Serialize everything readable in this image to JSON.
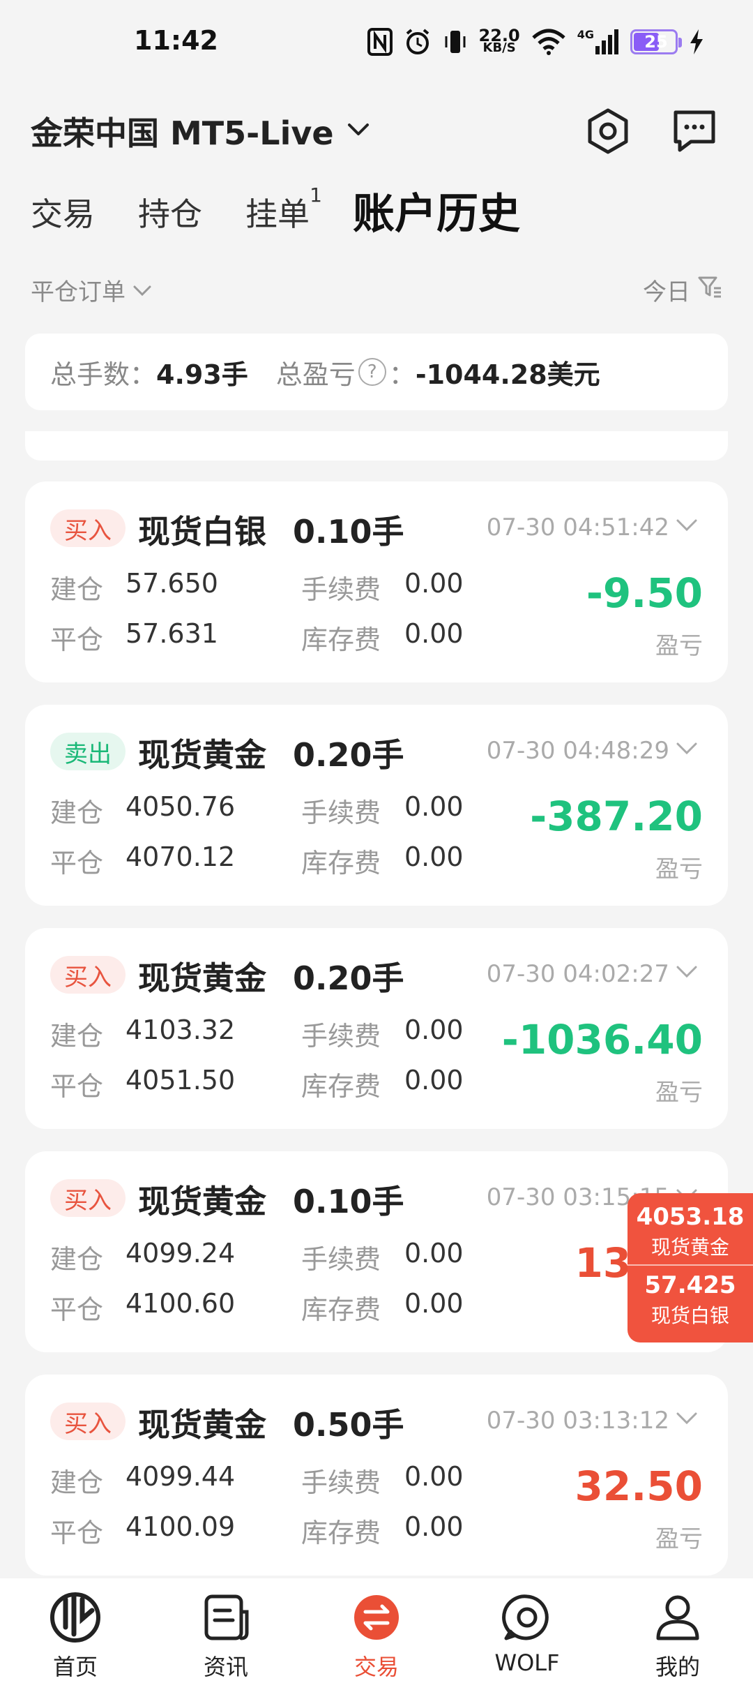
{
  "status_bar": {
    "time": "11:42",
    "net_speed": "22.0",
    "net_unit": "KB/S",
    "network": "4G",
    "battery": "25"
  },
  "header": {
    "account": "金荣中国 MT5-Live"
  },
  "tabs": [
    {
      "label": "交易"
    },
    {
      "label": "持仓"
    },
    {
      "label": "挂单",
      "count": "1"
    },
    {
      "label": "账户历史",
      "active": true
    }
  ],
  "filter": {
    "type": "平仓订单",
    "range": "今日"
  },
  "summary": {
    "lots_label": "总手数：",
    "lots_value": "4.93手",
    "pl_label": "总盈亏",
    "pl_colon": "：",
    "pl_value": "-1044.28美元"
  },
  "labels": {
    "open": "建仓",
    "close": "平仓",
    "fee": "手续费",
    "swap": "库存费",
    "pl": "盈亏"
  },
  "trades": [
    {
      "side": "买入",
      "symbol": "现货白银",
      "lots": "0.10手",
      "time": "07-30 04:51:42",
      "open": "57.650",
      "close": "57.631",
      "fee": "0.00",
      "swap": "0.00",
      "pl": "-9.50"
    },
    {
      "side": "卖出",
      "symbol": "现货黄金",
      "lots": "0.20手",
      "time": "07-30 04:48:29",
      "open": "4050.76",
      "close": "4070.12",
      "fee": "0.00",
      "swap": "0.00",
      "pl": "-387.20"
    },
    {
      "side": "买入",
      "symbol": "现货黄金",
      "lots": "0.20手",
      "time": "07-30 04:02:27",
      "open": "4103.32",
      "close": "4051.50",
      "fee": "0.00",
      "swap": "0.00",
      "pl": "-1036.40"
    },
    {
      "side": "买入",
      "symbol": "现货黄金",
      "lots": "0.10手",
      "time": "07-30 03:15:15",
      "open": "4099.24",
      "close": "4100.60",
      "fee": "0.00",
      "swap": "0.00",
      "pl": "13.60"
    },
    {
      "side": "买入",
      "symbol": "现货黄金",
      "lots": "0.50手",
      "time": "07-30 03:13:12",
      "open": "4099.44",
      "close": "4100.09",
      "fee": "0.00",
      "swap": "0.00",
      "pl": "32.50"
    }
  ],
  "float_prices": [
    {
      "price": "4053.18",
      "name": "现货黄金"
    },
    {
      "price": "57.425",
      "name": "现货白银"
    }
  ],
  "nav": [
    {
      "label": "首页",
      "icon": "home-logo-icon"
    },
    {
      "label": "资讯",
      "icon": "news-icon"
    },
    {
      "label": "交易",
      "icon": "trade-icon",
      "active": true
    },
    {
      "label": "WOLF",
      "icon": "wolf-chat-icon"
    },
    {
      "label": "我的",
      "icon": "profile-icon"
    }
  ],
  "colors": {
    "loss": "#1fc27e",
    "profit": "#ea4f36",
    "buy_badge": "#e8543f",
    "sell_badge": "#19b877",
    "accent": "#ea4f36"
  }
}
